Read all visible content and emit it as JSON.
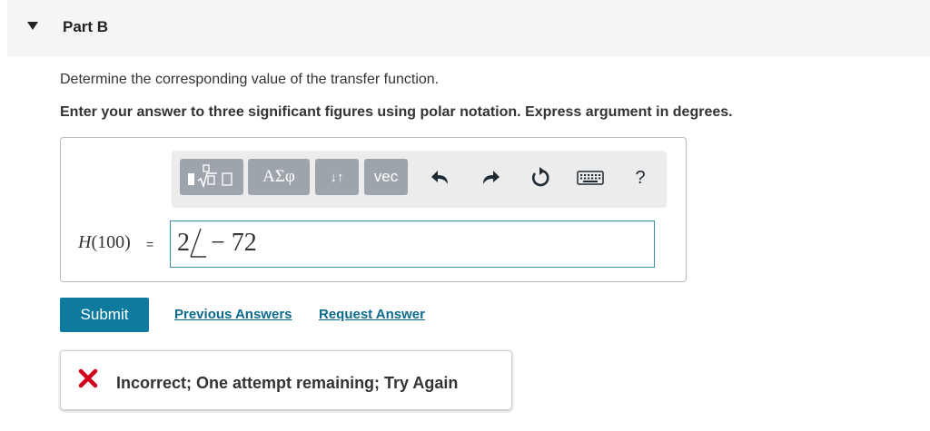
{
  "part": {
    "title": "Part B"
  },
  "question": "Determine the corresponding value of the transfer function.",
  "instruction": "Enter your answer to three significant figures using polar notation. Express argument in degrees.",
  "toolbar": {
    "templates_icon": "templates-icon",
    "greek_label": "ΑΣφ",
    "updown_label": "↓↑",
    "vec_label": "vec",
    "undo_icon": "undo-icon",
    "redo_icon": "redo-icon",
    "reset_icon": "reset-icon",
    "keyboard_icon": "keyboard-icon",
    "help_label": "?"
  },
  "answer": {
    "label_fn": "H",
    "label_arg": "(100)",
    "equals": "=",
    "magnitude": "2",
    "angle": "− 72"
  },
  "buttons": {
    "submit": "Submit",
    "previous_answers": "Previous Answers",
    "request_answer": "Request Answer"
  },
  "feedback": {
    "text": "Incorrect; One attempt remaining; Try Again",
    "icon": "x-mark-icon"
  },
  "colors": {
    "accent": "#0d7a9e",
    "error": "#d0021b",
    "input_border": "#3a8fa8"
  }
}
